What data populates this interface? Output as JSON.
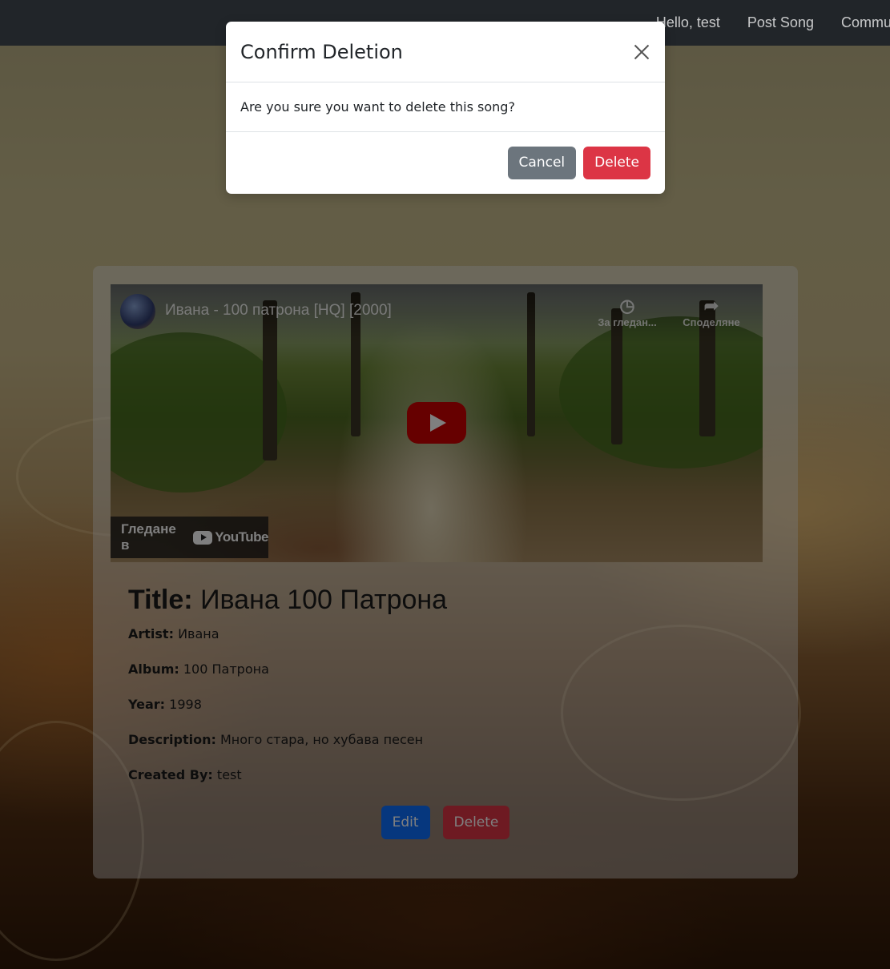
{
  "nav": {
    "greeting": "Hello, test",
    "post_song": "Post Song",
    "community": "Community"
  },
  "video": {
    "title": "Ивана - 100 патрона [HQ] [2000]",
    "watch_later": "За гледан...",
    "share": "Споделяне",
    "watch_on": "Гледане в",
    "youtube": "YouTube"
  },
  "song": {
    "title_label": "Title:",
    "title": "Ивана 100 Патрона",
    "artist_label": "Artist:",
    "artist": "Ивана",
    "album_label": "Album:",
    "album": "100 Патрона",
    "year_label": "Year:",
    "year": "1998",
    "description_label": "Description:",
    "description": "Много стара, но хубава песен",
    "created_by_label": "Created By:",
    "created_by": "test",
    "edit_label": "Edit",
    "delete_label": "Delete"
  },
  "modal": {
    "title": "Confirm Deletion",
    "message": "Are you sure you want to delete this song?",
    "cancel_label": "Cancel",
    "delete_label": "Delete"
  },
  "colors": {
    "primary": "#0d6efd",
    "danger": "#dc3545",
    "secondary": "#6c757d",
    "navbar": "#212529"
  }
}
